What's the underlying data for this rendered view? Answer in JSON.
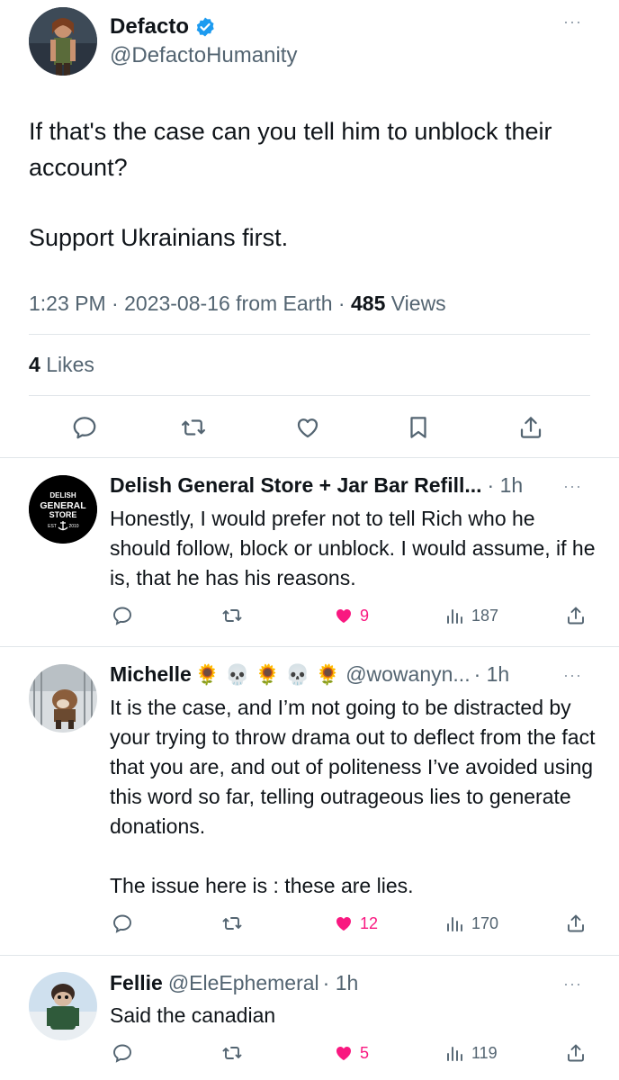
{
  "main_tweet": {
    "author_name": "Defacto",
    "author_handle": "@DefactoHumanity",
    "text_line1": "If that's the case can you tell him to unblock their account?",
    "text_line2": "Support Ukrainians first.",
    "time": "1:23 PM",
    "date": "2023-08-16",
    "source": "from Earth",
    "views_count": "485",
    "views_label": "Views",
    "likes_count": "4",
    "likes_label": "Likes",
    "more_label": "···"
  },
  "replies": [
    {
      "avatar_text": [
        "DELISH",
        "GENERAL",
        "STORE",
        "EST",
        "2010"
      ],
      "name": "Delish General Store + Jar Bar Refill...",
      "handle": "",
      "time": "· 1h",
      "text": [
        "Honestly, I would prefer not to tell Rich who he should follow, block or unblock. I would assume, if he is, that he has his reasons."
      ],
      "likes": "9",
      "views": "187"
    },
    {
      "name": "Michelle",
      "emojis": "🌻 💀 🌻 💀 🌻",
      "handle": "@wowanyn...",
      "time": "· 1h",
      "text": [
        "It is the case, and I’m not going to be distracted by your trying to throw drama out to deflect from the fact that you are, and out of politeness I’ve avoided using this word so far, telling outrageous lies to generate donations.",
        "The issue here is : these are lies."
      ],
      "likes": "12",
      "views": "170"
    },
    {
      "name": "Fellie",
      "handle": "@EleEphemeral",
      "time": "· 1h",
      "text": [
        "Said the canadian"
      ],
      "likes": "5",
      "views": "119"
    }
  ],
  "colors": {
    "like_pink": "#f91880",
    "verified_blue": "#1d9bf0",
    "secondary_text": "#536471"
  }
}
